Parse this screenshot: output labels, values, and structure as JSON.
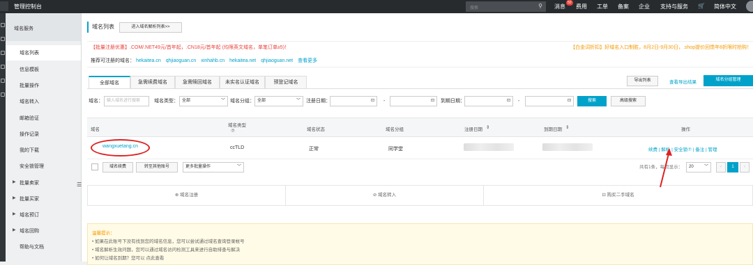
{
  "topbar": {
    "brand": "管理控制台",
    "search_placeholder": "搜索",
    "badge": "50",
    "nav": [
      "消息",
      "费用",
      "工单",
      "备案",
      "企业",
      "支持与服务",
      "简体中文"
    ],
    "cart_icon": "cart-icon"
  },
  "sidebar": {
    "header": "域名服务",
    "items": [
      "域名列表",
      "信息模板",
      "批量操作",
      "域名转入",
      "邮箱验证",
      "操作记录",
      "我的下载",
      "安全锁管理"
    ],
    "groups": [
      "批量卖家",
      "批量买家",
      "域名预订",
      "域名回购"
    ],
    "help": "帮助与文档"
  },
  "main": {
    "title": "域名列表",
    "enter_dns_btn": "进入域名解析列表>>",
    "promo_left": "【批量注册优惠】.COM/.NET49元/首年起，.CN18元/首年起 (均限英文域名，单笔订单≥5)！",
    "promo_right": "【白金词折扣】好域名入口制胜，8月2日-9月30日，.shop提价回馈年8折限时抢购！",
    "rec_label": "推荐可注册的域名：",
    "rec_domains": [
      "hekaitea.cn",
      "qhjiaoguan.cn",
      "xinhahb.cn",
      "hekaitea.net",
      "qhjiaoguan.net"
    ],
    "rec_more": "查看更多",
    "tabs": [
      "全部域名",
      "急需续费域名",
      "急需赎回域名",
      "未实名认证域名",
      "预登记域名"
    ],
    "export_btn": "导出列表",
    "export_result": "查看导出结果",
    "group_mgmt_btn": "域名分组管理",
    "filter": {
      "domain_label": "域名：",
      "domain_placeholder": "输入域名进行搜索",
      "type_label": "域名类型：",
      "type_value": "全部",
      "group_label": "域名分组：",
      "group_value": "全部",
      "reg_label": "注册日期：",
      "dash": "-",
      "exp_label": "到期日期：",
      "search_btn": "搜索",
      "advanced_btn": "高级搜索"
    },
    "table": {
      "headers": [
        "域名",
        "域名类型",
        "域名状态",
        "域名分组",
        "注册日期",
        "到期日期",
        "操作"
      ],
      "row": {
        "domain": "wangxuetang.cn",
        "type": "ccTLD",
        "status": "正常",
        "group": "同学堂",
        "actions": "续费 | 解析 | 安全锁⑦ | 备注 | 管理"
      }
    },
    "batch": {
      "renew": "域名续费",
      "transfer": "转至其他账号",
      "more": "更多批量操作"
    },
    "pager": {
      "summary": "共有1条，每页显示：",
      "size": "20",
      "page": "1"
    },
    "bottom_links": [
      "域名注册",
      "域名转入",
      "购买二手域名"
    ],
    "tips": {
      "title": "温馨提示：",
      "lines": [
        "• 如果在此账号下没有找到您的域名信息，您可以尝试通过域名查询登录帐号",
        "• 域名解析生效问题，您可以通过域名访问检测工具来进行自助排查与解决",
        "• 如何让域名到期？您可以 点此查看"
      ]
    }
  }
}
